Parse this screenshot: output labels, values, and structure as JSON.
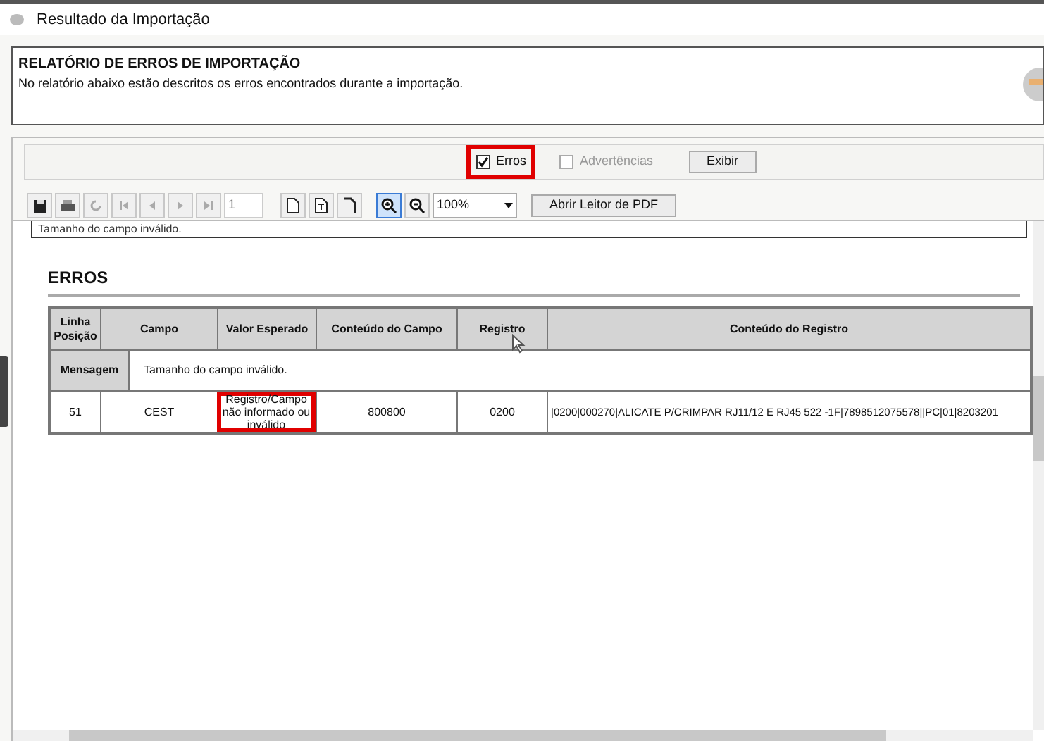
{
  "window": {
    "title": "Resultado da Importação"
  },
  "header": {
    "title": "RELATÓRIO DE ERROS DE IMPORTAÇÃO",
    "description": "No relatório abaixo estão descritos os erros encontrados durante a importação."
  },
  "filters": [
    {
      "label": "Erros",
      "checked": true,
      "disabled": false,
      "highlighted": true
    },
    {
      "label": "Advertências",
      "checked": false,
      "disabled": true,
      "highlighted": false
    }
  ],
  "show_button": "Exibir",
  "toolbar": {
    "page": "1",
    "zoom": "100%",
    "pdf_button": "Abrir Leitor de PDF"
  },
  "report": {
    "cut_text": "Tamanho do campo inválido.",
    "section_title": "ERROS",
    "columns": [
      "Linha Posição",
      "Campo",
      "Valor Esperado",
      "Conteúdo do Campo",
      "Registro",
      "Conteúdo do Registro"
    ],
    "message_label": "Mensagem",
    "message": "Tamanho do campo inválido.",
    "rows": [
      {
        "cells": [
          {
            "text": "51",
            "highlighted": false
          },
          {
            "text": "CEST",
            "highlighted": false
          },
          {
            "text": "Registro/Campo não informado ou inválido",
            "highlighted": true
          },
          {
            "text": "800800",
            "highlighted": false
          },
          {
            "text": "0200",
            "highlighted": false
          },
          {
            "text": "|0200|000270|ALICATE P/CRIMPAR RJ11/12 E RJ45 522 -1F|7898512075578||PC|01|8203201",
            "highlighted": false
          }
        ]
      }
    ]
  }
}
